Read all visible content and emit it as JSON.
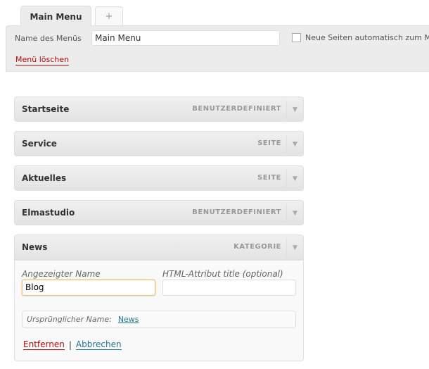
{
  "tabs": {
    "active_label": "Main Menu",
    "add_label": "+"
  },
  "menu_header": {
    "name_label": "Name des Menüs",
    "name_value": "Main Menu",
    "auto_add_label": "Neue Seiten automatisch zum M",
    "auto_add_checked": false,
    "delete_label": "Menü löschen"
  },
  "items": [
    {
      "title": "Startseite",
      "type": "BENUTZERDEFINIERT"
    },
    {
      "title": "Service",
      "type": "SEITE"
    },
    {
      "title": "Aktuelles",
      "type": "SEITE"
    },
    {
      "title": "Elmastudio",
      "type": "BENUTZERDEFINIERT"
    }
  ],
  "expanded_item": {
    "title": "News",
    "type": "KATEGORIE",
    "nav_label_caption": "Angezeigter Name",
    "nav_label_value": "Blog",
    "title_attr_caption": "HTML-Attribut title (optional)",
    "title_attr_value": "",
    "original_label": "Ursprünglicher Name:",
    "original_link": "News",
    "remove_label": "Entfernen",
    "separator": "|",
    "cancel_label": "Abbrechen"
  },
  "icons": {
    "toggle": "triangle-down-icon"
  }
}
